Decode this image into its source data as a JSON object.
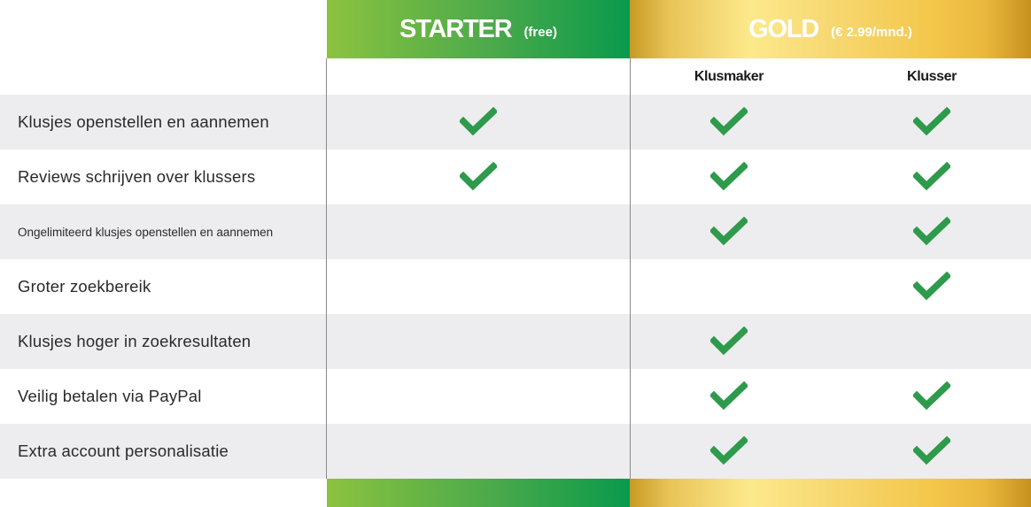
{
  "plans": {
    "starter": {
      "name": "STARTER",
      "price": "(free)"
    },
    "gold": {
      "name": "GOLD",
      "price": "(€ 2.99/mnd.)"
    }
  },
  "gold_tiers": [
    "Klusmaker",
    "Klusser"
  ],
  "rows": [
    {
      "label": "Klusjes openstellen en aannemen",
      "starter": true,
      "klusmaker": true,
      "klusser": true
    },
    {
      "label": "Reviews schrijven over klussers",
      "starter": true,
      "klusmaker": true,
      "klusser": true
    },
    {
      "label": "Ongelimiteerd klusjes openstellen en aannemen",
      "starter": false,
      "klusmaker": true,
      "klusser": true
    },
    {
      "label": "Groter zoekbereik",
      "starter": false,
      "klusmaker": false,
      "klusser": true
    },
    {
      "label": "Klusjes hoger in zoekresultaten",
      "starter": false,
      "klusmaker": true,
      "klusser": false
    },
    {
      "label": "Veilig betalen via PayPal",
      "starter": false,
      "klusmaker": true,
      "klusser": true
    },
    {
      "label": "Extra account personalisatie",
      "starter": false,
      "klusmaker": true,
      "klusser": true
    }
  ],
  "colors": {
    "check": "#2e9a4c",
    "row_shade": "#ededef"
  },
  "icons": {
    "included": "check-icon"
  }
}
